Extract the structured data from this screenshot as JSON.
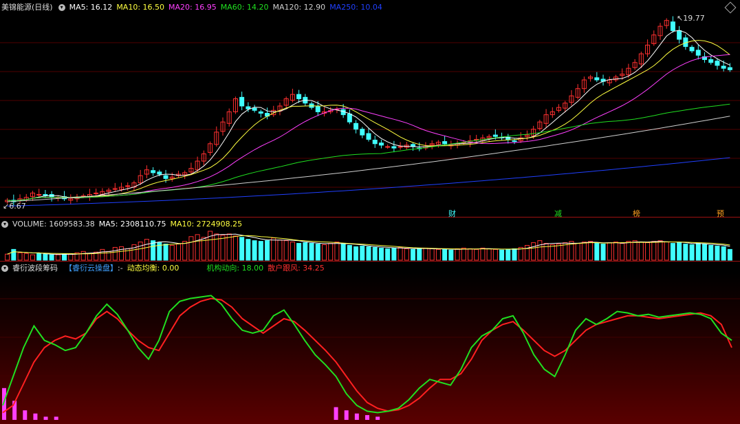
{
  "colors": {
    "ma5": "#ffffff",
    "ma10": "#ffff40",
    "ma20": "#ff40ff",
    "ma60": "#20e020",
    "ma120": "#d0d0d0",
    "ma250": "#2040ff",
    "up": "#ff3030",
    "down": "#40ffff",
    "red": "#ff2020",
    "green": "#20e020"
  },
  "icons": {
    "collapse": "expand-diamond-icon",
    "toggle": "dropdown-circle-icon"
  },
  "main": {
    "name": "美锦能源(日线)",
    "ma5": "MA5: 16.12",
    "ma10": "MA10: 16.50",
    "ma20": "MA20: 16.95",
    "ma60": "MA60: 14.20",
    "ma120": "MA120: 12.90",
    "ma250": "MA250: 10.04",
    "high_label": "19.77",
    "low_label": "6.67",
    "tags": [
      "财",
      "减",
      "榜",
      "预"
    ]
  },
  "volume": {
    "label": "VOLUME: 1609583.38",
    "ma5": "MA5: 2308110.75",
    "ma10": "MA10: 2724908.25"
  },
  "indicator": {
    "name": "睿衍波段筹码",
    "sub": "【睿衍云操盘】",
    "dash": ":-",
    "l1": "动态均衡: 0.00",
    "l2": "机构动向: 18.00",
    "l3": "散户跟风: 34.25"
  },
  "chart_data": {
    "type": "candlestick",
    "price_range": [
      6.67,
      19.77
    ],
    "closes": [
      7.1,
      7.0,
      7.2,
      7.3,
      7.6,
      7.5,
      7.4,
      7.3,
      7.3,
      7.2,
      7.2,
      7.3,
      7.4,
      7.5,
      7.6,
      7.7,
      7.8,
      7.9,
      8.0,
      8.1,
      8.3,
      8.8,
      9.2,
      9.0,
      8.9,
      8.6,
      8.7,
      8.9,
      9.0,
      9.3,
      9.8,
      10.3,
      11.0,
      11.8,
      12.5,
      13.2,
      14.1,
      13.6,
      13.4,
      13.3,
      13.1,
      12.9,
      13.3,
      13.6,
      14.1,
      14.4,
      14.1,
      13.8,
      13.5,
      13.2,
      13.2,
      13.3,
      13.4,
      13.0,
      12.5,
      12.0,
      11.6,
      11.3,
      11.0,
      10.9,
      10.8,
      10.7,
      10.8,
      10.9,
      10.8,
      10.7,
      10.8,
      11.0,
      11.1,
      11.0,
      10.9,
      11.0,
      11.1,
      11.2,
      11.3,
      11.4,
      11.5,
      11.5,
      11.4,
      11.3,
      11.2,
      11.4,
      11.6,
      12.0,
      12.5,
      13.0,
      13.2,
      13.5,
      13.8,
      14.3,
      14.8,
      15.4,
      15.6,
      15.4,
      15.3,
      15.4,
      15.6,
      15.8,
      16.2,
      16.6,
      17.2,
      17.8,
      18.5,
      19.1,
      19.5,
      18.8,
      18.2,
      17.7,
      17.4,
      17.1,
      16.8,
      16.6,
      16.4,
      16.2,
      16.1
    ],
    "volumes": [
      0.9,
      1.6,
      1.1,
      1.0,
      0.8,
      1.0,
      0.9,
      0.8,
      0.8,
      0.9,
      0.9,
      1.1,
      1.3,
      1.0,
      1.2,
      1.6,
      1.3,
      1.9,
      2.0,
      1.7,
      2.3,
      2.7,
      3.1,
      2.9,
      2.6,
      2.4,
      2.2,
      2.4,
      2.8,
      3.5,
      3.8,
      3.4,
      4.3,
      3.9,
      3.7,
      3.9,
      3.6,
      3.4,
      3.1,
      2.9,
      2.8,
      2.9,
      3.3,
      3.0,
      2.9,
      2.7,
      2.5,
      2.6,
      2.5,
      2.4,
      2.3,
      2.5,
      2.7,
      2.4,
      2.2,
      2.0,
      2.1,
      2.0,
      1.9,
      1.8,
      1.7,
      1.8,
      1.9,
      1.7,
      1.6,
      1.7,
      1.8,
      1.7,
      1.6,
      1.6,
      1.5,
      1.7,
      1.8,
      1.7,
      1.6,
      1.8,
      1.7,
      1.6,
      1.5,
      1.6,
      1.7,
      1.9,
      2.2,
      2.6,
      2.9,
      2.5,
      2.3,
      2.4,
      2.6,
      2.8,
      2.5,
      2.7,
      2.8,
      2.5,
      2.4,
      2.6,
      2.7,
      2.5,
      2.8,
      2.9,
      2.7,
      2.6,
      2.8,
      2.9,
      2.7,
      2.5,
      2.6,
      2.4,
      2.3,
      2.5,
      2.4,
      2.2,
      2.1,
      2.0,
      1.6
    ],
    "series_green": [
      10,
      30,
      50,
      65,
      55,
      52,
      48,
      50,
      60,
      72,
      80,
      73,
      62,
      50,
      42,
      55,
      75,
      82,
      84,
      85,
      86,
      80,
      70,
      62,
      60,
      62,
      72,
      76,
      66,
      55,
      45,
      38,
      30,
      18,
      10,
      6,
      5,
      6,
      8,
      14,
      22,
      28,
      26,
      24,
      35,
      50,
      58,
      62,
      70,
      72,
      60,
      45,
      35,
      30,
      45,
      62,
      70,
      66,
      70,
      75,
      74,
      72,
      73,
      71,
      72,
      73,
      74,
      73,
      70,
      60,
      55
    ],
    "series_red": [
      5,
      10,
      25,
      40,
      50,
      55,
      58,
      56,
      60,
      70,
      75,
      70,
      62,
      55,
      50,
      48,
      60,
      72,
      78,
      82,
      84,
      83,
      78,
      70,
      65,
      60,
      65,
      70,
      68,
      62,
      55,
      48,
      40,
      30,
      20,
      12,
      8,
      6,
      7,
      10,
      15,
      22,
      28,
      28,
      32,
      42,
      55,
      62,
      66,
      68,
      62,
      55,
      48,
      44,
      48,
      55,
      62,
      66,
      68,
      70,
      72,
      72,
      71,
      70,
      71,
      72,
      73,
      74,
      72,
      66,
      50
    ]
  }
}
